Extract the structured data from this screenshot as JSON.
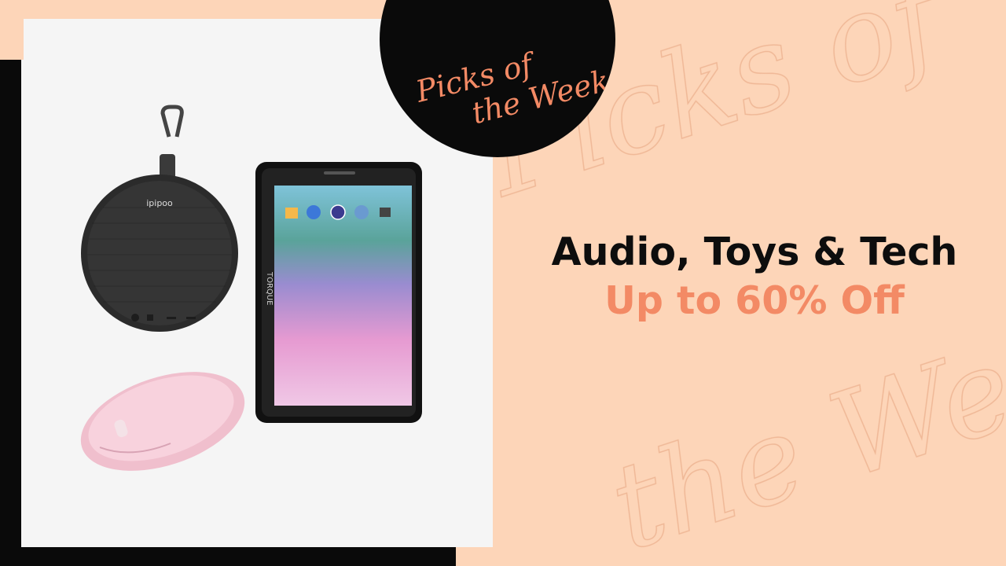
{
  "badge": {
    "line1": "Picks of",
    "line2": "the Week"
  },
  "watermark": {
    "line1": "Picks of",
    "line2": "the Week"
  },
  "headline": {
    "title": "Audio, Toys & Tech",
    "subtitle": "Up to 60% Off"
  },
  "products": {
    "speaker_brand": "ipipoo",
    "tablet_brand": "TORQUE"
  },
  "colors": {
    "background": "#fdd5b8",
    "accent": "#f38a65",
    "dark": "#0a0a0a",
    "card": "#f5f5f5"
  }
}
